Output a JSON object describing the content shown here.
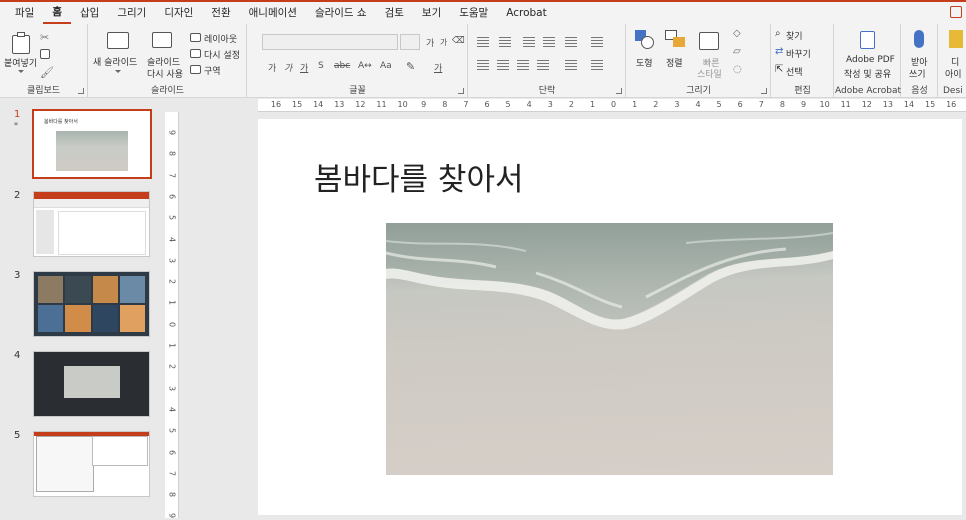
{
  "tabs": [
    "파일",
    "홈",
    "삽입",
    "그리기",
    "디자인",
    "전환",
    "애니메이션",
    "슬라이드 쇼",
    "검토",
    "보기",
    "도움말",
    "Acrobat"
  ],
  "active_tab": "홈",
  "ribbon": {
    "clipboard": {
      "label": "클립보드",
      "paste": "붙여넣기"
    },
    "slides": {
      "label": "슬라이드",
      "new_slide": "새 슬라이드",
      "reuse": "다시 사용",
      "reuse_prefix": "슬라이드",
      "layout": "레이아웃",
      "reset": "다시 설정",
      "section": "구역"
    },
    "font": {
      "label": "글꼴",
      "bold": "가",
      "italic": "가",
      "underline": "가",
      "strike": "S",
      "size_up": "가",
      "size_down": "가"
    },
    "paragraph": {
      "label": "단락"
    },
    "drawing": {
      "label": "그리기",
      "shapes": "도형",
      "arrange": "정렬",
      "quick_styles_1": "빠른",
      "quick_styles_2": "스타일"
    },
    "editing": {
      "label": "편집",
      "find": "찾기",
      "replace": "바꾸기",
      "select": "선택"
    },
    "acrobat": {
      "label": "Adobe Acrobat",
      "line1": "Adobe PDF",
      "line2": "작성 및 공유"
    },
    "voice": {
      "label": "음성",
      "line1": "받아",
      "line2": "쓰기"
    },
    "designer": {
      "label": "Desi",
      "line1": "디",
      "line2": "아이"
    }
  },
  "slides": [
    {
      "num": "1",
      "star": "*",
      "title": "봄바다를 찾아서"
    },
    {
      "num": "2"
    },
    {
      "num": "3"
    },
    {
      "num": "4"
    },
    {
      "num": "5"
    }
  ],
  "hruler_labels": [
    "16",
    "15",
    "14",
    "13",
    "12",
    "11",
    "10",
    "9",
    "8",
    "7",
    "6",
    "5",
    "4",
    "3",
    "2",
    "1",
    "0",
    "1",
    "2",
    "3",
    "4",
    "5",
    "6",
    "7",
    "8",
    "9",
    "10",
    "11",
    "12",
    "13",
    "14",
    "15",
    "16"
  ],
  "vruler_labels": [
    "9",
    "8",
    "7",
    "6",
    "5",
    "4",
    "3",
    "2",
    "1",
    "0",
    "1",
    "2",
    "3",
    "4",
    "5",
    "6",
    "7",
    "8",
    "9"
  ],
  "slide": {
    "title": "봄바다를 찾아서"
  },
  "colors": {
    "accent": "#c43e1c"
  }
}
